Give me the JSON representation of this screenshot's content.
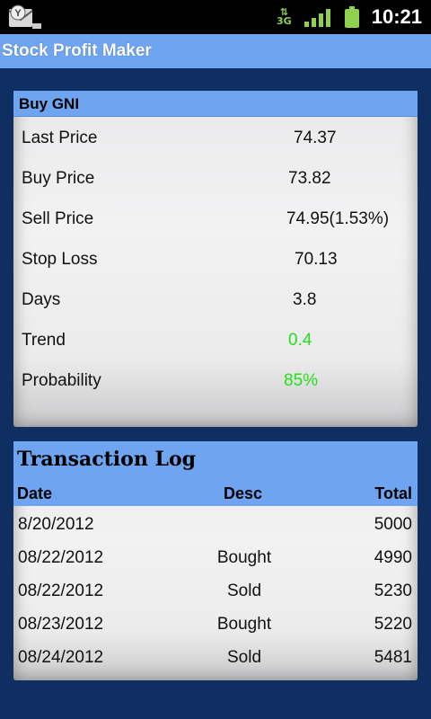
{
  "status": {
    "network": "3G",
    "time": "10:21"
  },
  "app": {
    "title": "Stock Profit Maker"
  },
  "stock_card": {
    "header": "Buy GNI",
    "rows": [
      {
        "label": "Last Price",
        "value": "74.37"
      },
      {
        "label": "Buy Price",
        "value": "73.82"
      },
      {
        "label": "Sell Price",
        "value": "74.95(1.53%)"
      },
      {
        "label": "Stop Loss",
        "value": "70.13"
      },
      {
        "label": "Days",
        "value": "3.8"
      },
      {
        "label": "Trend",
        "value": "0.4"
      },
      {
        "label": "Probability",
        "value": "85%"
      }
    ],
    "highlight_color": "#22e01a"
  },
  "log": {
    "title": "Transaction Log",
    "columns": {
      "date": "Date",
      "desc": "Desc",
      "total": "Total"
    },
    "rows": [
      {
        "date": "8/20/2012",
        "desc": "",
        "total": "5000"
      },
      {
        "date": "08/22/2012",
        "desc": "Bought",
        "total": "4990"
      },
      {
        "date": "08/22/2012",
        "desc": "Sold",
        "total": "5230"
      },
      {
        "date": "08/23/2012",
        "desc": "Bought",
        "total": "5220"
      },
      {
        "date": "08/24/2012",
        "desc": "Sold",
        "total": "5481"
      }
    ]
  },
  "colors": {
    "background": "#0f2f62",
    "header_blue": "#6fa5f0"
  }
}
